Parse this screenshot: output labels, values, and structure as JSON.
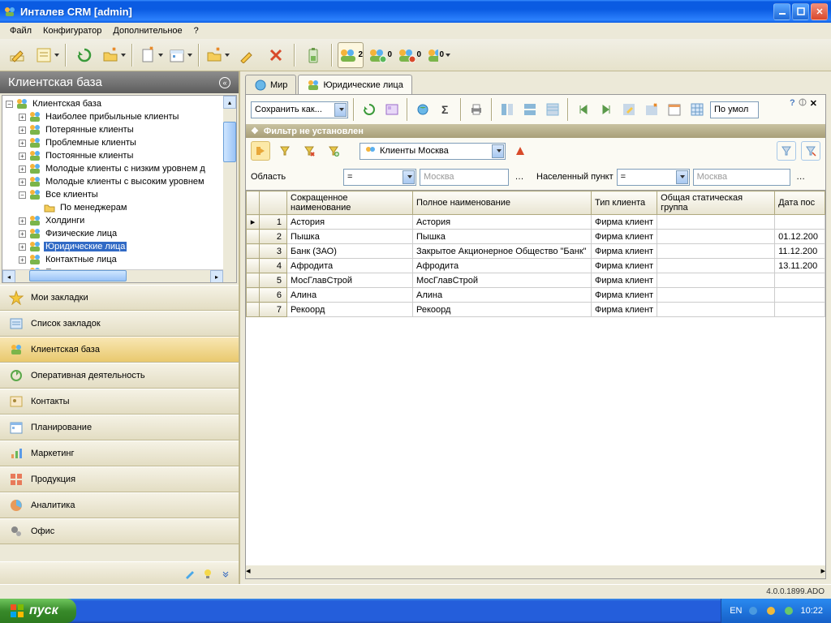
{
  "window": {
    "title": "Инталев CRM [admin]"
  },
  "menu": [
    "Файл",
    "Конфигуратор",
    "Дополнительное",
    "?"
  ],
  "side_header": "Клиентская база",
  "tree": {
    "root": "Клиентская база",
    "children": [
      {
        "label": "Наиболее прибыльные клиенты"
      },
      {
        "label": "Потерянные клиенты"
      },
      {
        "label": "Проблемные клиенты"
      },
      {
        "label": "Постоянные клиенты"
      },
      {
        "label": "Молодые клиенты с низким уровнем д"
      },
      {
        "label": "Молодые клиенты с высоким уровнем"
      },
      {
        "label": "Все клиенты",
        "expanded": true,
        "child": "По менеджерам"
      },
      {
        "label": "Холдинги"
      },
      {
        "label": "Физические лица"
      },
      {
        "label": "Юридические лица",
        "selected": true
      },
      {
        "label": "Контактные лица"
      },
      {
        "label": "Партнеры"
      }
    ]
  },
  "nav": [
    {
      "label": "Мои закладки",
      "icon": "star"
    },
    {
      "label": "Список закладок",
      "icon": "list"
    },
    {
      "label": "Клиентская база",
      "icon": "people",
      "active": true
    },
    {
      "label": "Оперативная деятельность",
      "icon": "cycle"
    },
    {
      "label": "Контакты",
      "icon": "contact"
    },
    {
      "label": "Планирование",
      "icon": "calendar"
    },
    {
      "label": "Маркетинг",
      "icon": "bars"
    },
    {
      "label": "Продукция",
      "icon": "grid"
    },
    {
      "label": "Аналитика",
      "icon": "pie"
    },
    {
      "label": "Офис",
      "icon": "gears"
    }
  ],
  "tabs": [
    {
      "label": "Мир",
      "icon": "globe"
    },
    {
      "label": "Юридические лица",
      "icon": "people",
      "active": true
    }
  ],
  "toolbar2": {
    "save_as": "Сохранить как...",
    "default": "По умол"
  },
  "filter_bar": "Фильтр не установлен",
  "region": {
    "combo": "Клиенты  Москва"
  },
  "filter_row": {
    "field_label": "Область",
    "op": "=",
    "val": "Москва",
    "city_label": "Населенный пункт",
    "city_op": "=",
    "city_val": "Москва"
  },
  "columns": [
    "",
    "",
    "Сокращенное наименование",
    "Полное наименование",
    "Тип клиента",
    "Общая статическая группа",
    "Дата пос"
  ],
  "rows": [
    {
      "n": "1",
      "marker": "▸",
      "short": "Астория",
      "full": "Астория",
      "type": "Фирма клиент",
      "grp": "",
      "date": ""
    },
    {
      "n": "2",
      "marker": "",
      "short": "Пышка",
      "full": "Пышка",
      "type": "Фирма клиент",
      "grp": "",
      "date": "01.12.200"
    },
    {
      "n": "3",
      "marker": "",
      "short": "Банк (ЗАО)",
      "full": "Закрытое Акционерное Общество  \"Банк\"",
      "type": "Фирма клиент",
      "grp": "",
      "date": "11.12.200"
    },
    {
      "n": "4",
      "marker": "",
      "short": "Афродита",
      "full": "Афродита",
      "type": "Фирма клиент",
      "grp": "",
      "date": "13.11.200"
    },
    {
      "n": "5",
      "marker": "",
      "short": "МосГлавСтрой",
      "full": "МосГлавСтрой",
      "type": "Фирма клиент",
      "grp": "",
      "date": ""
    },
    {
      "n": "6",
      "marker": "",
      "short": "Алина",
      "full": "Алина",
      "type": "Фирма клиент",
      "grp": "",
      "date": ""
    },
    {
      "n": "7",
      "marker": "",
      "short": "Рекоорд",
      "full": "Рекоорд",
      "type": "Фирма клиент",
      "grp": "",
      "date": ""
    }
  ],
  "status": "4.0.0.1899.ADO",
  "taskbar": {
    "start": "пуск",
    "lang": "EN",
    "time": "10:22"
  },
  "group_counts": [
    "2",
    "0",
    "0",
    "0"
  ]
}
